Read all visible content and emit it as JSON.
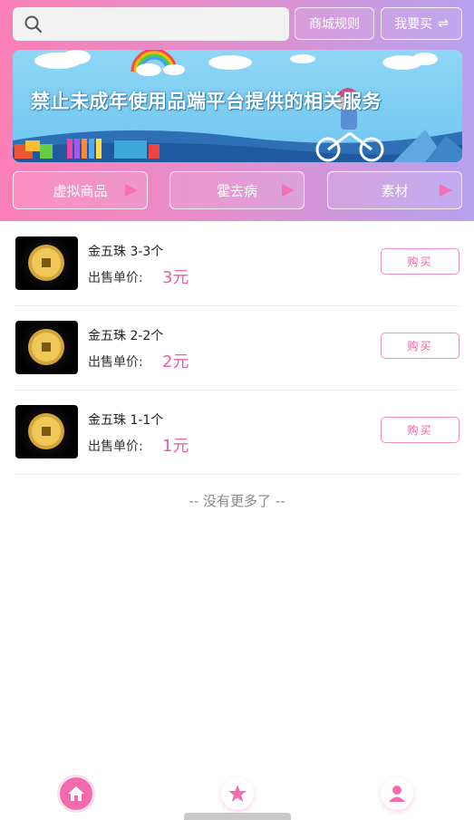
{
  "header": {
    "search": {
      "placeholder": "",
      "icon": "search-icon"
    },
    "rules_label": "商城规则",
    "want_buy_label": "我要买",
    "swap_icon": "⇌"
  },
  "banner": {
    "text": "禁止未成年使用品端平台提供的相关服务"
  },
  "categories": [
    {
      "label": "虚拟商品"
    },
    {
      "label": "霍去病"
    },
    {
      "label": "素材"
    }
  ],
  "items": [
    {
      "name": "金五珠 3-3个",
      "price_label": "出售单价:",
      "price": "3元",
      "buy_label": "购买"
    },
    {
      "name": "金五珠 2-2个",
      "price_label": "出售单价:",
      "price": "2元",
      "buy_label": "购买"
    },
    {
      "name": "金五珠 1-1个",
      "price_label": "出售单价:",
      "price": "1元",
      "buy_label": "购买"
    }
  ],
  "footer": {
    "no_more": "-- 没有更多了 --"
  },
  "tabbar": {
    "icons": [
      "home-icon",
      "star-icon",
      "user-icon"
    ]
  },
  "colors": {
    "accent": "#ef5fa7",
    "gradient_start": "#fb7fb6",
    "gradient_end": "#b6a2ef"
  }
}
